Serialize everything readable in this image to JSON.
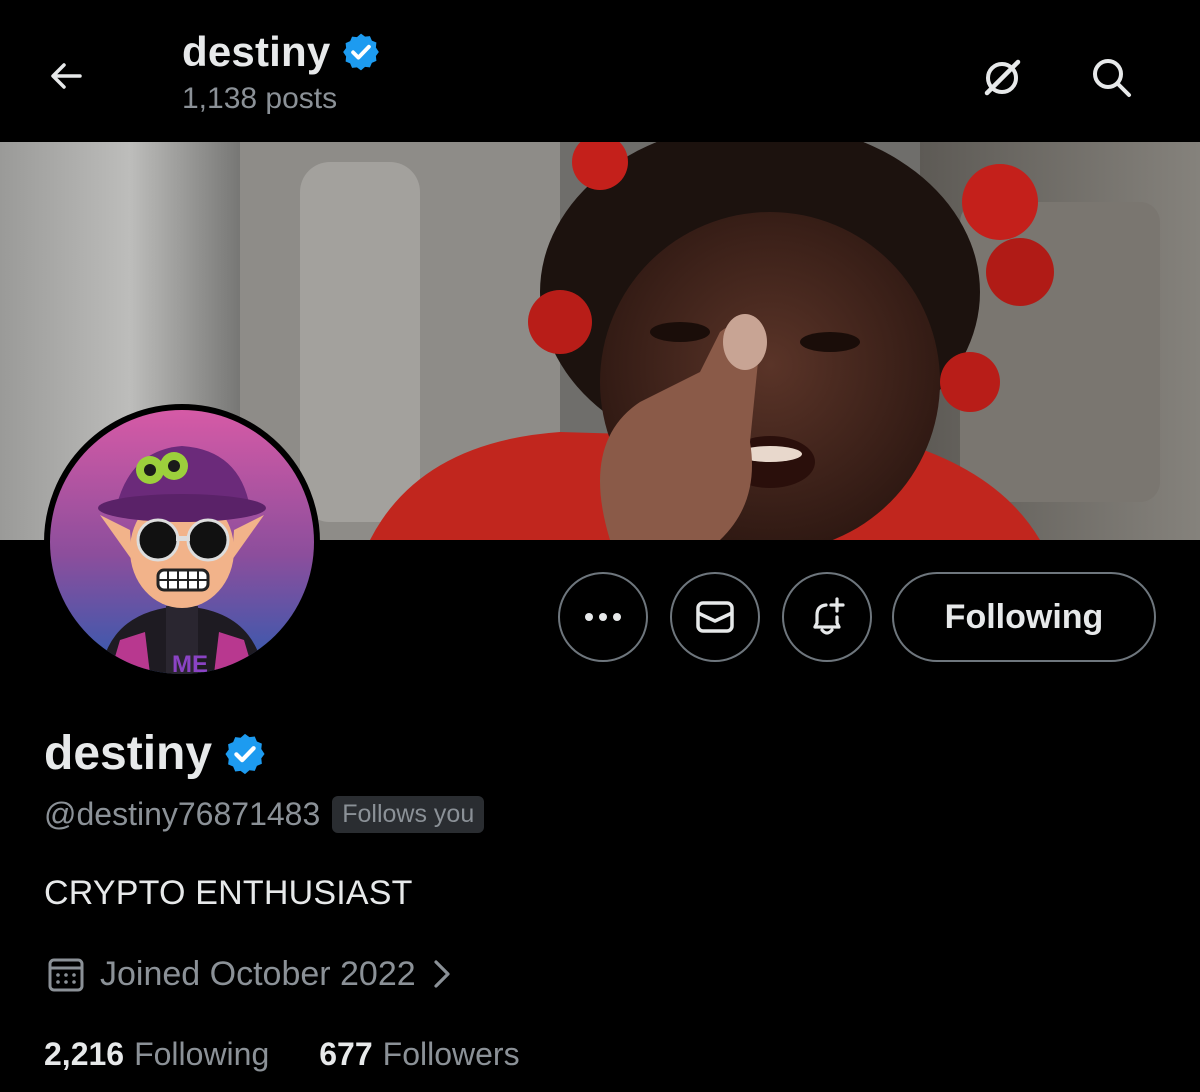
{
  "header": {
    "name": "destiny",
    "posts": "1,138 posts",
    "back_icon": "arrow-left-icon",
    "grok_icon": "grok-icon",
    "search_icon": "search-icon"
  },
  "profile": {
    "name": "destiny",
    "handle": "@destiny76871483",
    "follows_you": "Follows you",
    "bio": "CRYPTO ENTHUSIAST",
    "joined": "Joined October 2022",
    "following_count": "2,216",
    "following_label": "Following",
    "followers_count": "677",
    "followers_label": "Followers",
    "verified_color": "#1d9bf0"
  },
  "actions": {
    "more_icon": "more-icon",
    "message_icon": "envelope-icon",
    "notify_icon": "bell-plus-icon",
    "follow_label": "Following"
  }
}
